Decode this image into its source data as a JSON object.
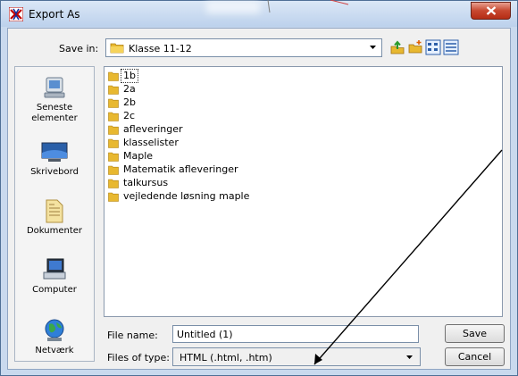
{
  "window": {
    "title": "Export As",
    "close_icon": "close-x-icon"
  },
  "toolbar": {
    "save_in_label": "Save in:",
    "save_in_value": "Klasse 11-12",
    "buttons": [
      "up-one-level-icon",
      "new-folder-icon",
      "list-view-icon",
      "details-view-icon"
    ]
  },
  "places": [
    {
      "label": "Seneste\nelementer",
      "icon": "recent-items-icon"
    },
    {
      "label": "Skrivebord",
      "icon": "desktop-icon"
    },
    {
      "label": "Dokumenter",
      "icon": "documents-icon"
    },
    {
      "label": "Computer",
      "icon": "computer-icon"
    },
    {
      "label": "Netværk",
      "icon": "network-icon"
    }
  ],
  "files": [
    {
      "name": "1b",
      "selected": true
    },
    {
      "name": "2a"
    },
    {
      "name": "2b"
    },
    {
      "name": "2c"
    },
    {
      "name": "afleveringer"
    },
    {
      "name": "klasselister"
    },
    {
      "name": "Maple"
    },
    {
      "name": "Matematik afleveringer"
    },
    {
      "name": "talkursus"
    },
    {
      "name": "vejledende løsning maple"
    }
  ],
  "form": {
    "file_name_label": "File name:",
    "file_name_value": "Untitled (1)",
    "file_type_label": "Files of type:",
    "file_type_value": "HTML (.html, .htm)"
  },
  "buttons": {
    "save": "Save",
    "cancel": "Cancel"
  },
  "colors": {
    "folder": "#e8b830",
    "close": "#c7472f",
    "annotation": "#000000"
  }
}
